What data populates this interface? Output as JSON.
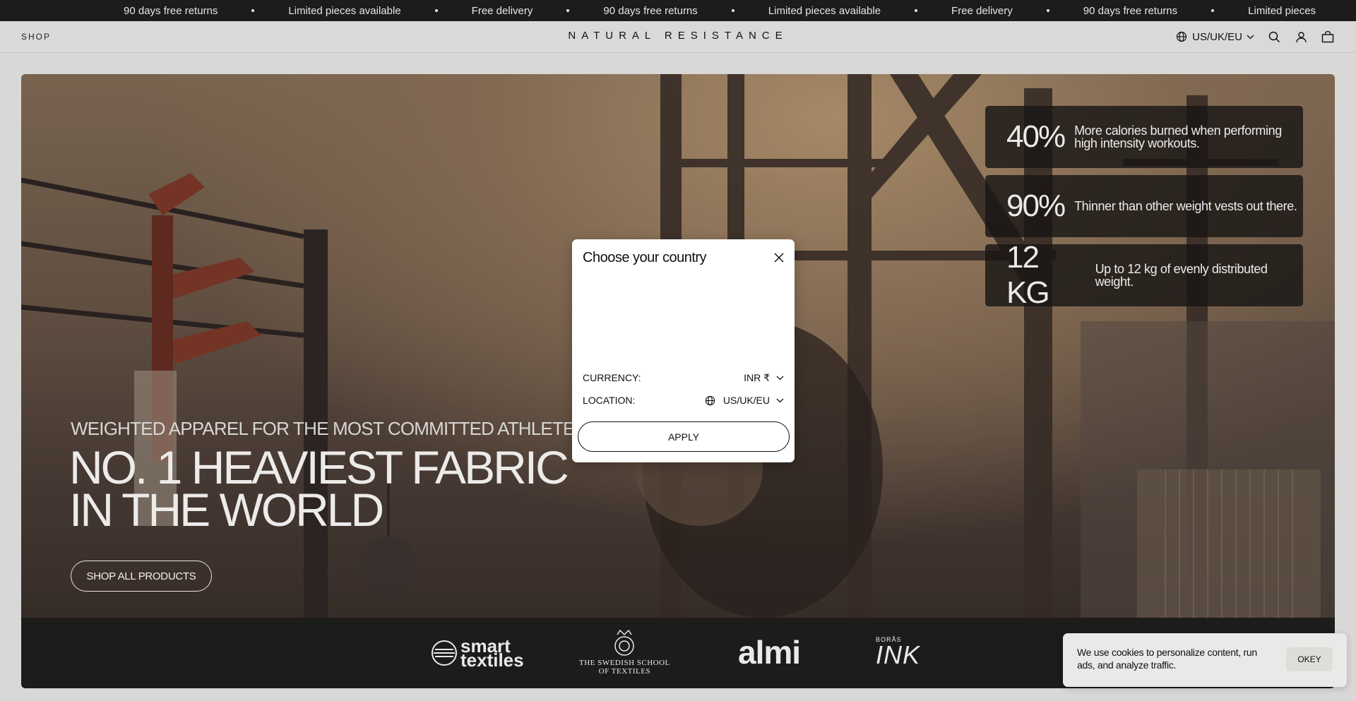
{
  "announcement": {
    "items": [
      "90 days free returns",
      "Limited pieces available",
      "Free delivery",
      "90 days free returns",
      "Limited pieces available",
      "Free delivery",
      "90 days free returns",
      "Limited pieces"
    ]
  },
  "header": {
    "shop_label": "SHOP",
    "logo": "NATURAL RESISTANCE",
    "region": "US/UK/EU"
  },
  "hero": {
    "stats": [
      {
        "big": "40%",
        "text": "More calories burned when performing high intensity workouts."
      },
      {
        "big": "90%",
        "text": "Thinner than other weight vests out there."
      },
      {
        "big": "12 KG",
        "text": "Up to 12 kg of evenly distributed weight."
      }
    ],
    "kicker": "WEIGHTED APPAREL FOR THE MOST COMMITTED ATHLETES",
    "title_line1": "NO. 1 HEAVIEST FABRIC",
    "title_line2": "IN THE WORLD",
    "cta": "SHOP ALL PRODUCTS"
  },
  "partners": {
    "smart_line1": "smart",
    "smart_line2": "textiles",
    "swedish_line1": "THE SWEDISH SCHOOL",
    "swedish_line2": "OF TEXTILES",
    "almi": "almi",
    "boras_top": "BORÅS",
    "boras_main": "INK"
  },
  "modal": {
    "title": "Choose your country",
    "currency_label": "CURRENCY:",
    "currency_value": "INR ₹",
    "location_label": "LOCATION:",
    "location_value": "US/UK/EU",
    "apply": "APPLY"
  },
  "cookie": {
    "text": "We use cookies to personalize content, run ads, and analyze traffic.",
    "button": "OKEY"
  },
  "colors": {
    "announce_bg": "#1c1c1a",
    "page_bg": "#d8d8d6",
    "partners_bg": "#1c1c1b"
  }
}
